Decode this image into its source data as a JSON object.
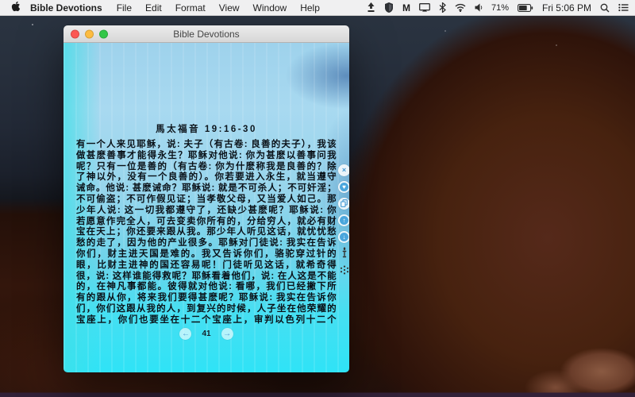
{
  "menu_bar": {
    "apple_icon": "apple-logo-icon",
    "app_name": "Bible Devotions",
    "menus": [
      "File",
      "Edit",
      "Format",
      "View",
      "Window",
      "Help"
    ],
    "status": {
      "battery_percent": "71%",
      "clock": "Fri 5:06 PM",
      "icons": [
        "up-arrow-bar-icon",
        "shield-icon",
        "malwarebytes-m-icon",
        "display-mirroring-icon",
        "bluetooth-icon",
        "wifi-icon",
        "volume-icon",
        "battery-icon",
        "spotlight-search-icon",
        "notification-list-icon"
      ]
    }
  },
  "window": {
    "title": "Bible Devotions",
    "traffic_lights": {
      "close": "#fc5753",
      "minimize": "#fdbc40",
      "zoom": "#33c748"
    },
    "passage_heading": "馬太福音 19:16-30",
    "passage_lines": [
      "有一个人来见耶稣，说: 夫子（有古卷: 良善的夫子），我该",
      "做甚麽善事才能得永生？耶稣对他说: 你为甚麽以善事问我",
      "呢？只有一位是善的（有古卷: 你为什麽称我是良善的？除",
      "了神以外，没有一个良善的）。你若要进入永生，就当遵守",
      "诫命。他说: 甚麽诫命？耶稣说: 就是不可杀人；不可奸淫；",
      "不可偷盗；不可作假见证；当孝敬父母，又当爱人如己。那",
      "少年人说: 这一切我都遵守了，还缺少甚麽呢？耶稣说: 你",
      "若愿意作完全人，可去变卖你所有的，分给穷人，就必有财",
      "宝在天上；你还要来跟从我。那少年人听见这话，就忧忧愁",
      "愁的走了，因为他的产业很多。耶稣对门徒说: 我实在告诉",
      "你们，财主进天国是难的。我又告诉你们，骆驼穿过针的",
      "眼，比财主进神的国还容易呢！门徒听见这话，就希奇得",
      "很，说: 这样谁能得救呢？耶稣看着他们，说: 在人这是不能",
      "的，在神凡事都能。彼得就对他说: 看哪，我们已经撇下所",
      "有的跟从你，将来我们要得甚麽呢？耶稣说: 我实在告诉你",
      "们，你们这跟从我的人，到复兴的时候，人子坐在他荣耀的",
      "宝座上，你们也要坐在十二个宝座上，审判以色列十二个"
    ],
    "pager": {
      "page": "41",
      "prev_icon": "arrow-left-icon",
      "next_icon": "arrow-right-icon"
    },
    "side_buttons": [
      {
        "icon": "close-x-icon",
        "glyph": "×"
      },
      {
        "icon": "heart-icon",
        "glyph": "♥"
      },
      {
        "icon": "copy-icon"
      },
      {
        "icon": "arrow-up-icon",
        "glyph": "↑"
      },
      {
        "icon": "arrow-down-icon",
        "glyph": "↓"
      },
      {
        "icon": "torch-icon"
      },
      {
        "icon": "dots-cluster-icon"
      }
    ]
  },
  "colors": {
    "accent_blue": "#4aa0d5",
    "window_cyan_bottom": "#2fe3f6",
    "window_blue_top": "#9ed2ec",
    "sky": "#27313d",
    "rock": "#4a2114",
    "menubar_bg": "#f7f7f7"
  }
}
